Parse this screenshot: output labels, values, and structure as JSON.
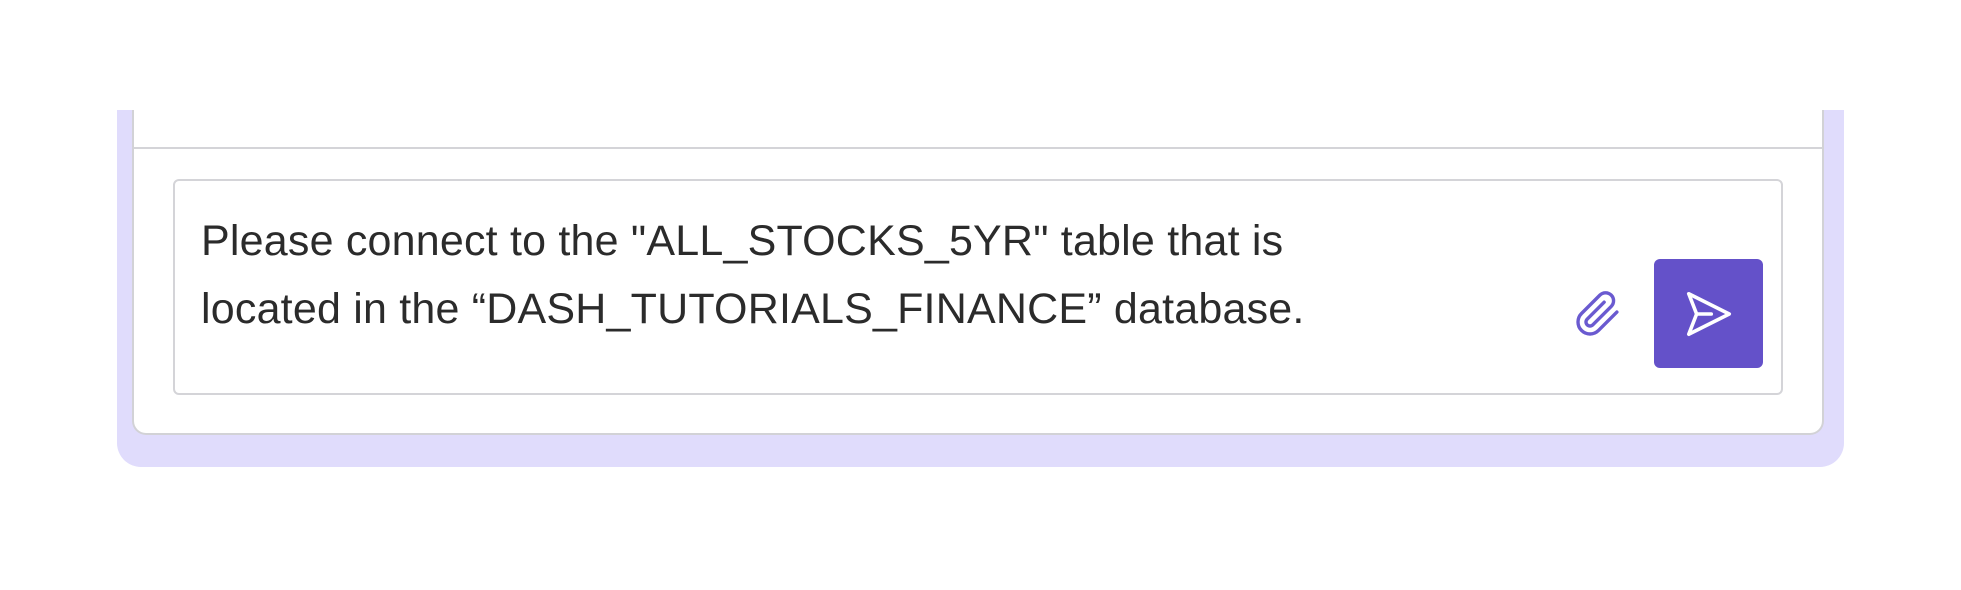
{
  "composer": {
    "text_line_1": "Please connect to the \"ALL_STOCKS_5YR\" table that is",
    "text_line_2": "located in the “DASH_TUTORIALS_FINANCE” database."
  },
  "icons": {
    "attach": "paperclip-icon",
    "send": "send-icon"
  },
  "colors": {
    "halo": "#e0dcfc",
    "send_button": "#6451c9",
    "attach_icon": "#6a5ad0",
    "text": "#2b2b2b"
  }
}
